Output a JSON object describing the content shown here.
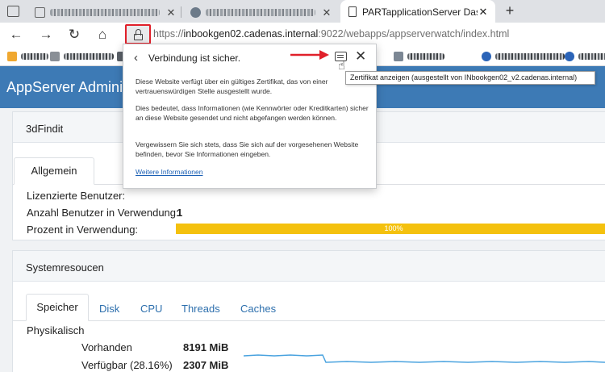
{
  "browser": {
    "tabs": [
      {
        "title": "",
        "active": false
      },
      {
        "title": "",
        "active": false
      },
      {
        "title": "",
        "active": false
      },
      {
        "title": "PARTapplicationServer Dashboard",
        "active": true
      }
    ],
    "new_tab": "+",
    "nav": {
      "back": "←",
      "forward": "→",
      "reload": "↻",
      "home": "⌂"
    },
    "url": {
      "scheme": "https://",
      "host": "inbookgen02.cadenas.internal",
      "path": ":9022/webapps/appserverwatch/index.html"
    },
    "bookmark_count": 8
  },
  "site_info": {
    "back": "‹",
    "title": "Verbindung ist sicher.",
    "close": "✕",
    "paragraphs": [
      "Diese Website verfügt über ein gültiges Zertifikat, das von einer vertrauenswürdigen Stelle ausgestellt wurde.",
      "Dies bedeutet, dass Informationen (wie Kennwörter oder Kreditkarten) sicher an diese Website gesendet und nicht abgefangen werden können.",
      "Vergewissern Sie sich stets, dass Sie sich auf der vorgesehenen Website befinden, bevor Sie Informationen eingeben."
    ],
    "link": "Weitere Informationen",
    "tooltip": "Zertifikat anzeigen (ausgestellt von INbookgen02_v2.cadenas.internal)"
  },
  "app": {
    "title": "AppServer Administ",
    "panel1": {
      "title": "3dFindit",
      "tab": "Allgemein",
      "rows": [
        {
          "label": "Lizenzierte Benutzer:",
          "value": ""
        },
        {
          "label": "Anzahl Benutzer in Verwendung:",
          "value": "1"
        },
        {
          "label": "Prozent in Verwendung:",
          "value": ""
        }
      ],
      "progress": {
        "percent": 100,
        "label": "100%",
        "color": "#f4c10e"
      }
    },
    "panel2": {
      "title": "Systemresoucen",
      "tabs": [
        "Speicher",
        "Disk",
        "CPU",
        "Threads",
        "Caches"
      ],
      "section": "Physikalisch",
      "rows": [
        {
          "label": "Vorhanden",
          "value": "8191 MiB"
        },
        {
          "label": "Verfügbar (28.16%)",
          "value": "2307 MiB"
        }
      ]
    },
    "colors": {
      "header": "#3d7ab5",
      "link": "#2d6fad",
      "annotation": "#e0202a",
      "sparkline": "#4aa3df"
    }
  }
}
